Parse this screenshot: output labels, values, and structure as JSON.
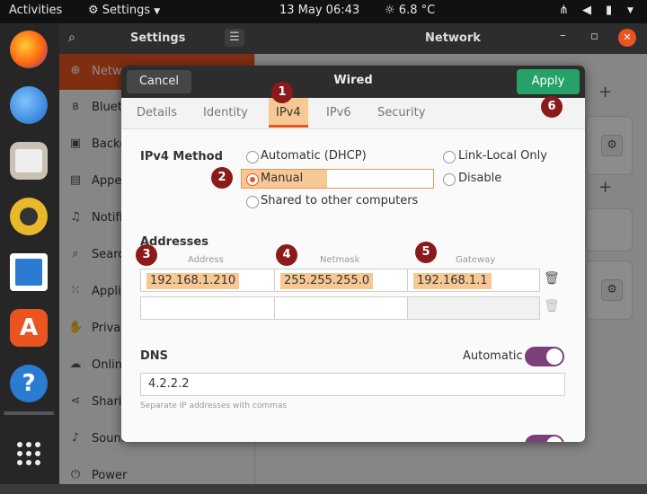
{
  "topbar": {
    "activities": "Activities",
    "app_menu": "Settings",
    "clock": "13 May  06:43",
    "weather": "6.8 °C"
  },
  "settings": {
    "header_title": "Settings",
    "panel_title": "Network",
    "sidebar": [
      {
        "label": "Network"
      },
      {
        "label": "Bluetooth"
      },
      {
        "label": "Background"
      },
      {
        "label": "Appearance"
      },
      {
        "label": "Notifications"
      },
      {
        "label": "Search"
      },
      {
        "label": "Applications"
      },
      {
        "label": "Privacy"
      },
      {
        "label": "Online Accounts"
      },
      {
        "label": "Sharing"
      },
      {
        "label": "Sound"
      },
      {
        "label": "Power"
      }
    ]
  },
  "dialog": {
    "title": "Wired",
    "cancel_label": "Cancel",
    "apply_label": "Apply",
    "tabs": [
      "Details",
      "Identity",
      "IPv4",
      "IPv6",
      "Security"
    ],
    "active_tab": "IPv4",
    "ipv4_method_label": "IPv4 Method",
    "methods": {
      "automatic": "Automatic (DHCP)",
      "link_local": "Link-Local Only",
      "manual": "Manual",
      "disable": "Disable",
      "shared": "Shared to other computers"
    },
    "selected_method": "Manual",
    "addresses_label": "Addresses",
    "columns": {
      "address": "Address",
      "netmask": "Netmask",
      "gateway": "Gateway"
    },
    "row": {
      "address": "192.168.1.210",
      "netmask": "255.255.255.0",
      "gateway": "192.168.1.1"
    },
    "dns_label": "DNS",
    "dns_automatic_label": "Automatic",
    "dns_automatic_on": true,
    "dns_value": "4.2.2.2",
    "dns_hint": "Separate IP addresses with commas"
  },
  "badges": {
    "b1": "1",
    "b2": "2",
    "b3": "3",
    "b4": "4",
    "b5": "5",
    "b6": "6"
  },
  "colors": {
    "apply_green": "#26a269",
    "badge_red": "#8b1a1a",
    "highlight": "#f8c894",
    "toggle_purple": "#7b3f7a",
    "accent_orange": "#e95420"
  }
}
